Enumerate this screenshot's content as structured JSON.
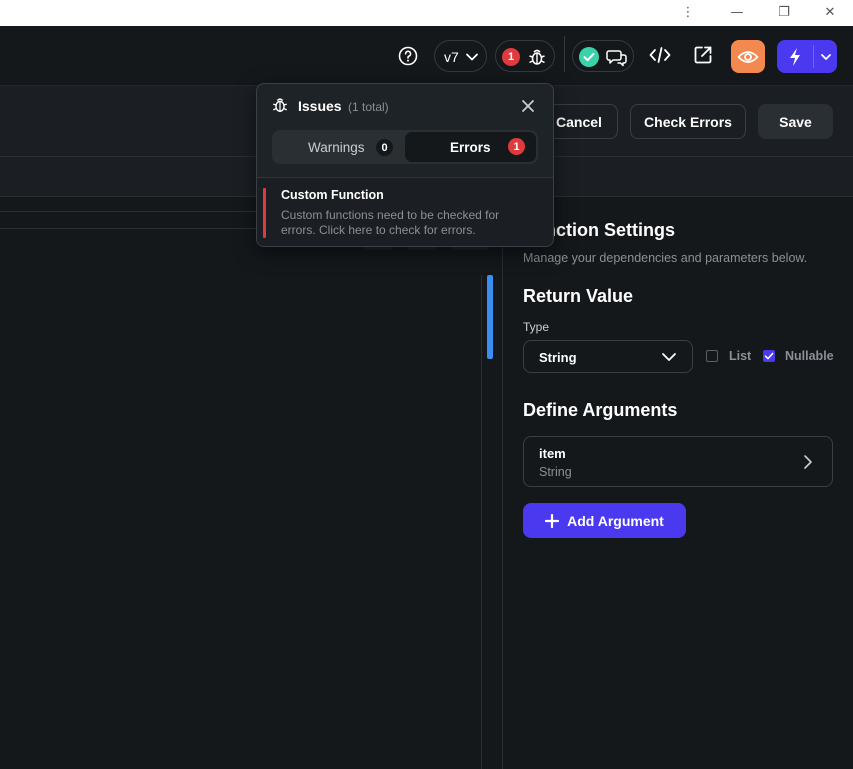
{
  "window": {
    "menu_glyph": "⋮",
    "minimize_glyph": "—",
    "restore_glyph": "❐",
    "close_glyph": "✕"
  },
  "toolbar": {
    "help_icon": "question-circle-icon",
    "version_label": "v7",
    "issues_count": "1",
    "bug_icon": "bug-icon",
    "code_icon": "code-icon",
    "open_external_icon": "external-link-icon",
    "preview_icon": "eye-icon",
    "run_icon": "lightning-icon",
    "accent_orange": "#f4894f",
    "accent_purple": "#4b39ef",
    "success_green": "#39d2a9",
    "error_red": "#e0393e"
  },
  "actions": {
    "cancel_label": "Cancel",
    "check_errors_label": "Check Errors",
    "save_label": "Save"
  },
  "issues_popup": {
    "title": "Issues",
    "total": "(1 total)",
    "warnings_label": "Warnings",
    "warnings_count": "0",
    "errors_label": "Errors",
    "errors_count": "1",
    "item_title": "Custom Function",
    "item_desc_line1": "Custom functions need to be checked for",
    "item_desc_line2": "errors. Click here to check for errors."
  },
  "settings": {
    "title": "Function Settings",
    "subtitle": "Manage your dependencies and parameters below.",
    "return_value_title": "Return Value",
    "type_label": "Type",
    "type_value": "String",
    "list_label": "List",
    "list_checked": false,
    "nullable_label": "Nullable",
    "nullable_checked": true,
    "define_args_title": "Define Arguments",
    "argument": {
      "name": "item",
      "type": "String"
    },
    "add_argument_label": "Add Argument"
  }
}
